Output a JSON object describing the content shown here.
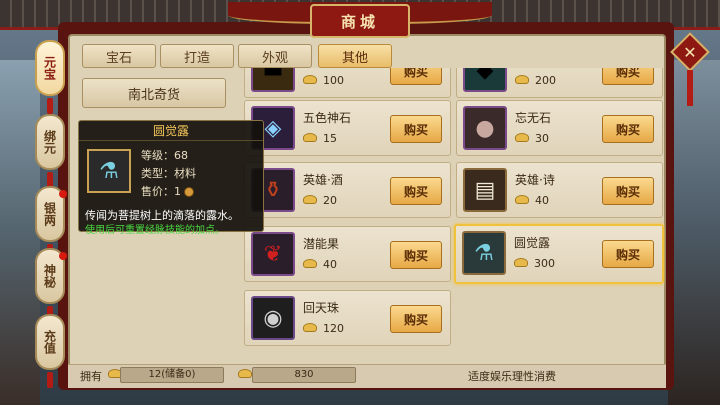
{
  "window": {
    "title": "商城"
  },
  "side_tabs": [
    {
      "label": "元宝",
      "active": true,
      "badge": false
    },
    {
      "label": "绑元",
      "active": false,
      "badge": false
    },
    {
      "label": "银两",
      "active": false,
      "badge": true
    },
    {
      "label": "神秘",
      "active": false,
      "badge": true
    },
    {
      "label": "充值",
      "active": false,
      "badge": false
    }
  ],
  "top_tabs": [
    {
      "label": "宝石",
      "active": false
    },
    {
      "label": "打造",
      "active": false
    },
    {
      "label": "外观",
      "active": false
    },
    {
      "label": "其他",
      "active": true
    }
  ],
  "category": {
    "label": "南北奇货"
  },
  "items": [
    {
      "name": "",
      "price": "100",
      "buy": "购买",
      "icon": "gold-bars-icon"
    },
    {
      "name": "",
      "price": "200",
      "buy": "购买",
      "icon": "jade-stone-icon"
    },
    {
      "name": "五色神石",
      "price": "15",
      "buy": "购买",
      "icon": "rainbow-stone-icon"
    },
    {
      "name": "忘无石",
      "price": "30",
      "buy": "购买",
      "icon": "forget-stone-icon"
    },
    {
      "name": "英雄·酒",
      "price": "20",
      "buy": "购买",
      "icon": "wine-jar-icon"
    },
    {
      "name": "英雄·诗",
      "price": "40",
      "buy": "购买",
      "icon": "poem-book-icon"
    },
    {
      "name": "潜能果",
      "price": "40",
      "buy": "购买",
      "icon": "potential-fruit-icon"
    },
    {
      "name": "圆觉露",
      "price": "300",
      "buy": "购买",
      "icon": "dew-bottle-icon",
      "selected": true
    },
    {
      "name": "回天珠",
      "price": "120",
      "buy": "购买",
      "icon": "bead-icon"
    }
  ],
  "tooltip": {
    "title": "圆觉露",
    "level_label": "等级：68",
    "type_label": "类型：材料",
    "price_label": "售价：1",
    "description": "传闻为菩提树上的滴落的露水。",
    "hint": "使用后可重置经脉技能的加点。"
  },
  "footer": {
    "own_label": "拥有",
    "ingot_amount": "12(储备0)",
    "locked_amount": "830",
    "note": "适度娱乐理性消费"
  },
  "colors": {
    "accent": "#8e1812",
    "gold": "#e6a845",
    "highlight": "#f0c23c",
    "hint_green": "#4ad640"
  }
}
